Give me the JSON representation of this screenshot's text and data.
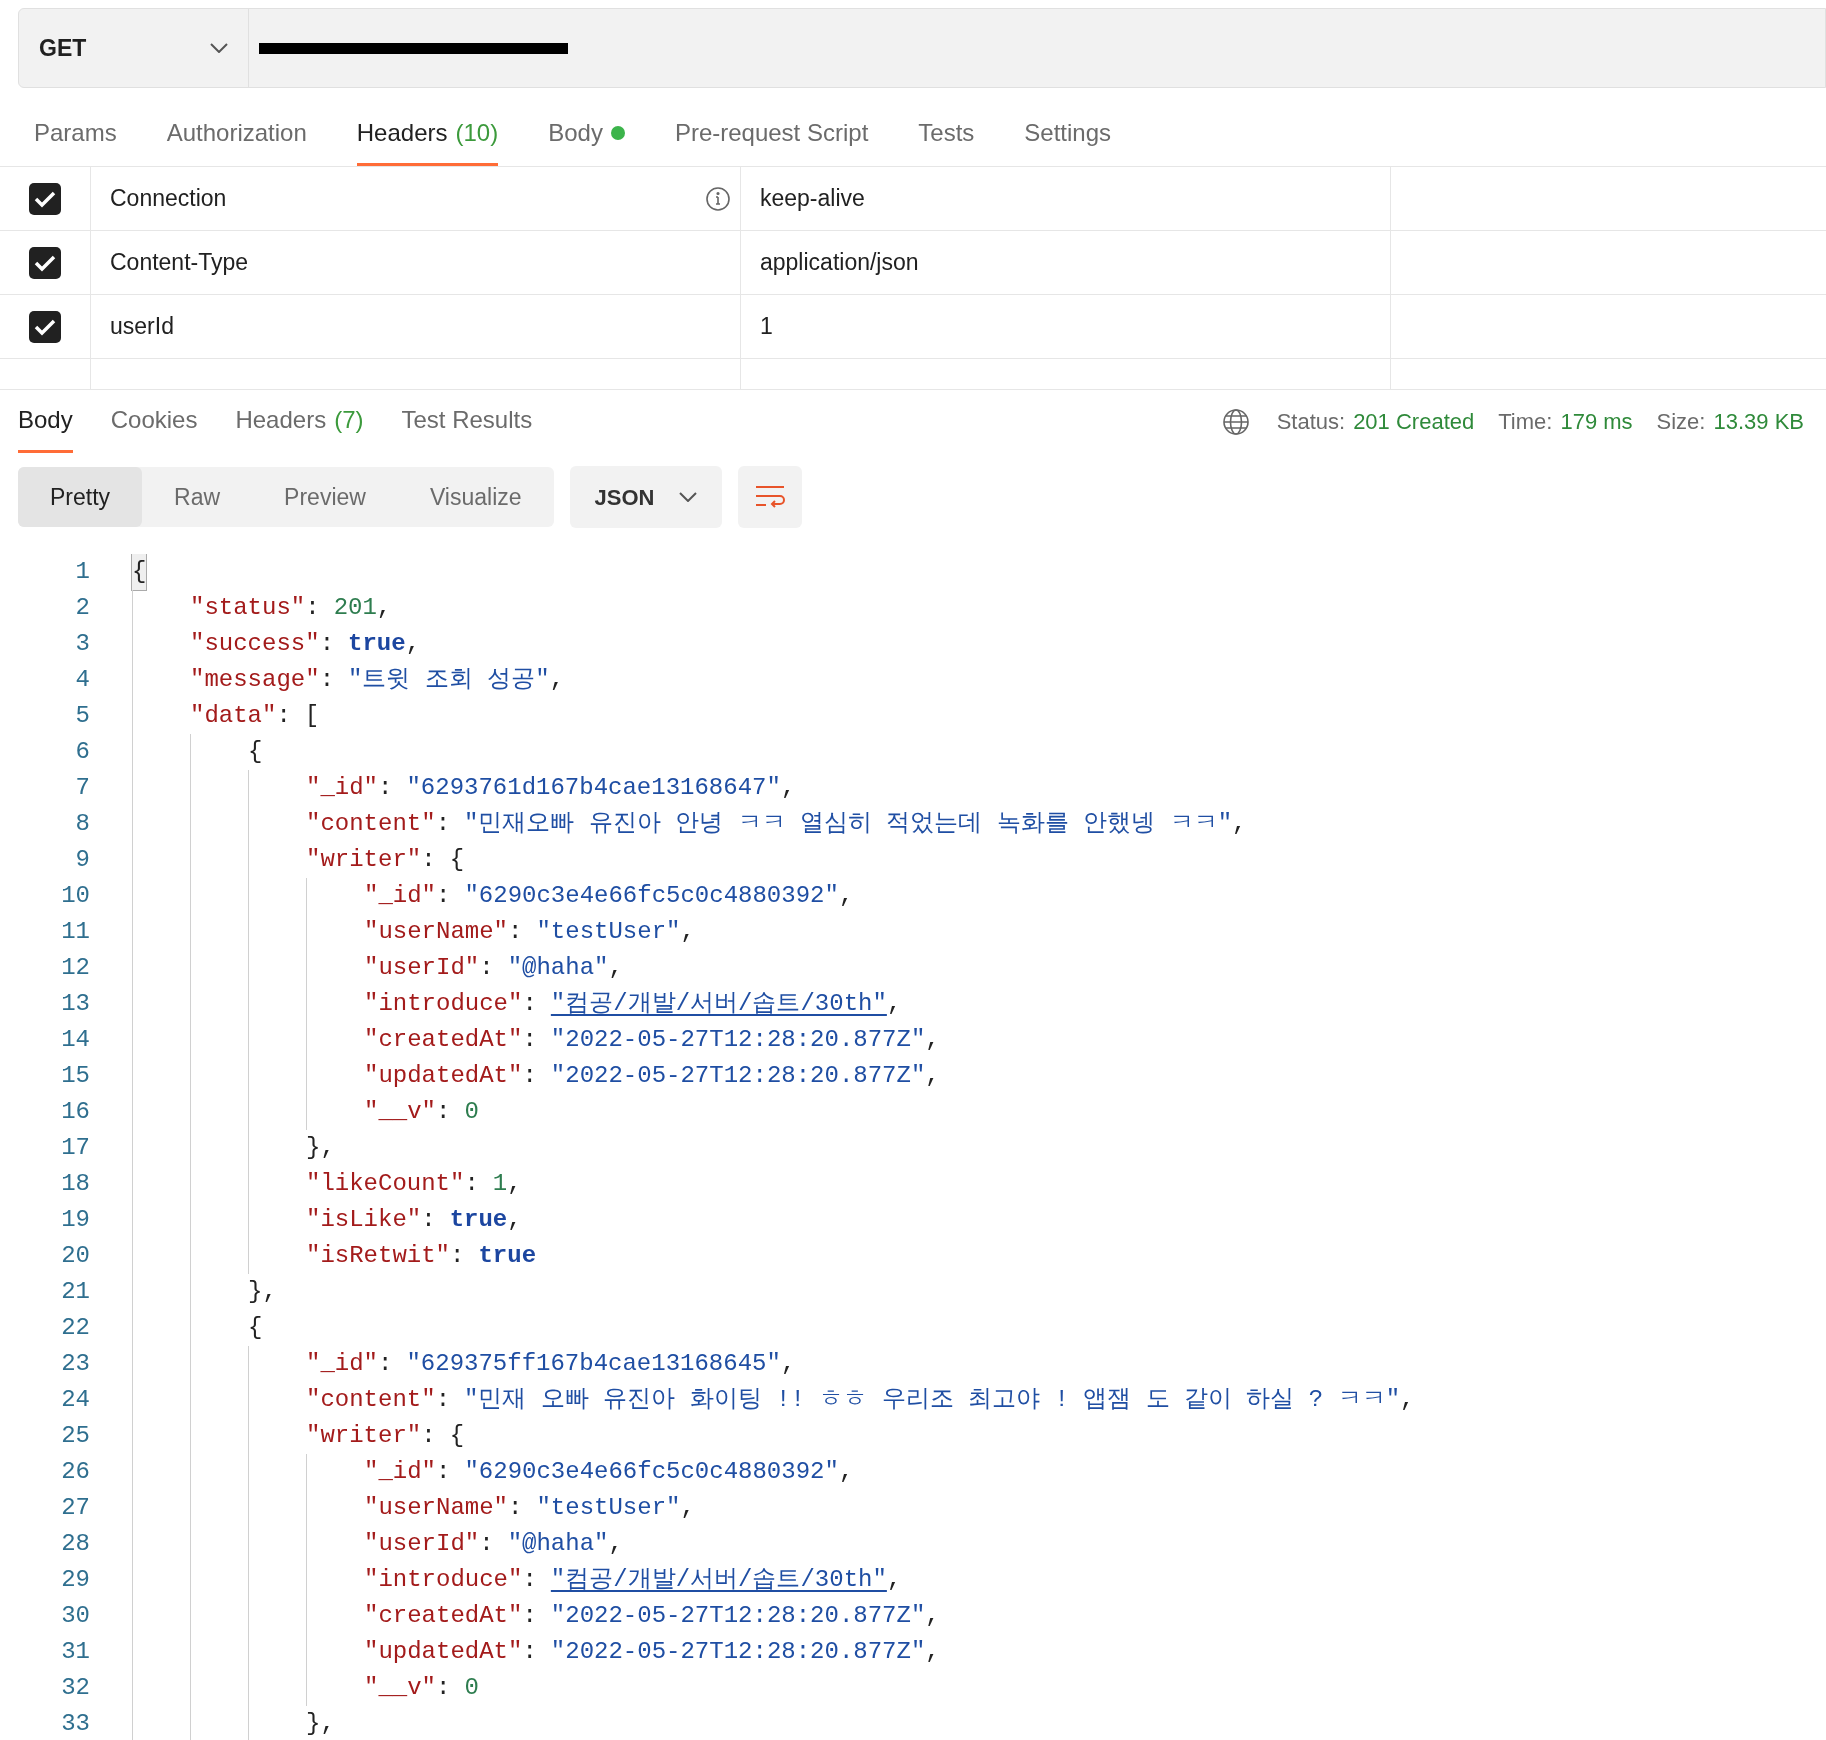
{
  "request": {
    "method": "GET",
    "tabs": [
      {
        "label": "Params",
        "selected": false
      },
      {
        "label": "Authorization",
        "selected": false
      },
      {
        "label": "Headers",
        "count": "(10)",
        "selected": true
      },
      {
        "label": "Body",
        "dot": true,
        "selected": false
      },
      {
        "label": "Pre-request Script",
        "selected": false
      },
      {
        "label": "Tests",
        "selected": false
      },
      {
        "label": "Settings",
        "selected": false
      }
    ],
    "headers": [
      {
        "checked": true,
        "key": "Connection",
        "info": true,
        "value": "keep-alive"
      },
      {
        "checked": true,
        "key": "Content-Type",
        "value": "application/json"
      },
      {
        "checked": true,
        "key": "userId",
        "value": "1"
      }
    ]
  },
  "response": {
    "tabs": [
      {
        "label": "Body",
        "selected": true
      },
      {
        "label": "Cookies",
        "selected": false
      },
      {
        "label": "Headers",
        "count": "(7)",
        "selected": false
      },
      {
        "label": "Test Results",
        "selected": false
      }
    ],
    "stats": [
      {
        "label": "Status:",
        "value": "201 Created"
      },
      {
        "label": "Time:",
        "value": "179 ms"
      },
      {
        "label": "Size:",
        "value": "13.39 KB"
      }
    ],
    "view_modes": [
      {
        "label": "Pretty",
        "selected": true
      },
      {
        "label": "Raw",
        "selected": false
      },
      {
        "label": "Preview",
        "selected": false
      },
      {
        "label": "Visualize",
        "selected": false
      }
    ],
    "format": "JSON",
    "lines": [
      {
        "n": "1",
        "tokens": [
          {
            "kind": "match",
            "text": "{"
          }
        ],
        "children": [
          {
            "n": "2",
            "tokens": [
              {
                "kind": "key",
                "text": "\"status\""
              },
              {
                "kind": "p",
                "text": ":"
              },
              {
                "kind": "num",
                "text": "201"
              },
              {
                "kind": "p",
                "text": ","
              }
            ]
          },
          {
            "n": "3",
            "tokens": [
              {
                "kind": "key",
                "text": "\"success\""
              },
              {
                "kind": "p",
                "text": ":"
              },
              {
                "kind": "bool",
                "text": "true"
              },
              {
                "kind": "p",
                "text": ","
              }
            ]
          },
          {
            "n": "4",
            "tokens": [
              {
                "kind": "key",
                "text": "\"message\""
              },
              {
                "kind": "p",
                "text": ":"
              },
              {
                "kind": "str",
                "text": "\"트윗 조회 성공\""
              },
              {
                "kind": "p",
                "text": ","
              }
            ]
          },
          {
            "n": "5",
            "tokens": [
              {
                "kind": "key",
                "text": "\"data\""
              },
              {
                "kind": "p",
                "text": ":"
              },
              {
                "kind": "p",
                "text": "["
              }
            ],
            "children": [
              {
                "n": "6",
                "tokens": [
                  {
                    "kind": "p",
                    "text": "{"
                  }
                ],
                "children": [
                  {
                    "n": "7",
                    "tokens": [
                      {
                        "kind": "key",
                        "text": "\"_id\""
                      },
                      {
                        "kind": "p",
                        "text": ":"
                      },
                      {
                        "kind": "str",
                        "text": "\"6293761d167b4cae13168647\""
                      },
                      {
                        "kind": "p",
                        "text": ","
                      }
                    ]
                  },
                  {
                    "n": "8",
                    "tokens": [
                      {
                        "kind": "key",
                        "text": "\"content\""
                      },
                      {
                        "kind": "p",
                        "text": ":"
                      },
                      {
                        "kind": "str",
                        "text": "\"민재오빠 유진아 안녕 ㅋㅋ 열심히 적었는데 녹화를 안했넹 ㅋㅋ\""
                      },
                      {
                        "kind": "p",
                        "text": ","
                      }
                    ]
                  },
                  {
                    "n": "9",
                    "tokens": [
                      {
                        "kind": "key",
                        "text": "\"writer\""
                      },
                      {
                        "kind": "p",
                        "text": ":"
                      },
                      {
                        "kind": "p",
                        "text": "{"
                      }
                    ],
                    "children": [
                      {
                        "n": "10",
                        "tokens": [
                          {
                            "kind": "key",
                            "text": "\"_id\""
                          },
                          {
                            "kind": "p",
                            "text": ":"
                          },
                          {
                            "kind": "str",
                            "text": "\"6290c3e4e66fc5c0c4880392\""
                          },
                          {
                            "kind": "p",
                            "text": ","
                          }
                        ]
                      },
                      {
                        "n": "11",
                        "tokens": [
                          {
                            "kind": "key",
                            "text": "\"userName\""
                          },
                          {
                            "kind": "p",
                            "text": ":"
                          },
                          {
                            "kind": "str",
                            "text": "\"testUser\""
                          },
                          {
                            "kind": "p",
                            "text": ","
                          }
                        ]
                      },
                      {
                        "n": "12",
                        "tokens": [
                          {
                            "kind": "key",
                            "text": "\"userId\""
                          },
                          {
                            "kind": "p",
                            "text": ":"
                          },
                          {
                            "kind": "str",
                            "text": "\"@haha\""
                          },
                          {
                            "kind": "p",
                            "text": ","
                          }
                        ]
                      },
                      {
                        "n": "13",
                        "tokens": [
                          {
                            "kind": "key",
                            "text": "\"introduce\""
                          },
                          {
                            "kind": "p",
                            "text": ":"
                          },
                          {
                            "kind": "link",
                            "text": "\"컴공/개발/서버/솝트/30th\""
                          },
                          {
                            "kind": "p",
                            "text": ","
                          }
                        ]
                      },
                      {
                        "n": "14",
                        "tokens": [
                          {
                            "kind": "key",
                            "text": "\"createdAt\""
                          },
                          {
                            "kind": "p",
                            "text": ":"
                          },
                          {
                            "kind": "str",
                            "text": "\"2022-05-27T12:28:20.877Z\""
                          },
                          {
                            "kind": "p",
                            "text": ","
                          }
                        ]
                      },
                      {
                        "n": "15",
                        "tokens": [
                          {
                            "kind": "key",
                            "text": "\"updatedAt\""
                          },
                          {
                            "kind": "p",
                            "text": ":"
                          },
                          {
                            "kind": "str",
                            "text": "\"2022-05-27T12:28:20.877Z\""
                          },
                          {
                            "kind": "p",
                            "text": ","
                          }
                        ]
                      },
                      {
                        "n": "16",
                        "tokens": [
                          {
                            "kind": "key",
                            "text": "\"__v\""
                          },
                          {
                            "kind": "p",
                            "text": ":"
                          },
                          {
                            "kind": "num",
                            "text": "0"
                          }
                        ]
                      }
                    ]
                  },
                  {
                    "n": "17",
                    "tokens": [
                      {
                        "kind": "p",
                        "text": "},"
                      }
                    ]
                  },
                  {
                    "n": "18",
                    "tokens": [
                      {
                        "kind": "key",
                        "text": "\"likeCount\""
                      },
                      {
                        "kind": "p",
                        "text": ":"
                      },
                      {
                        "kind": "num",
                        "text": "1"
                      },
                      {
                        "kind": "p",
                        "text": ","
                      }
                    ]
                  },
                  {
                    "n": "19",
                    "tokens": [
                      {
                        "kind": "key",
                        "text": "\"isLike\""
                      },
                      {
                        "kind": "p",
                        "text": ":"
                      },
                      {
                        "kind": "bool",
                        "text": "true"
                      },
                      {
                        "kind": "p",
                        "text": ","
                      }
                    ]
                  },
                  {
                    "n": "20",
                    "tokens": [
                      {
                        "kind": "key",
                        "text": "\"isRetwit\""
                      },
                      {
                        "kind": "p",
                        "text": ":"
                      },
                      {
                        "kind": "bool",
                        "text": "true"
                      }
                    ]
                  }
                ]
              },
              {
                "n": "21",
                "tokens": [
                  {
                    "kind": "p",
                    "text": "},"
                  }
                ]
              },
              {
                "n": "22",
                "tokens": [
                  {
                    "kind": "p",
                    "text": "{"
                  }
                ],
                "children": [
                  {
                    "n": "23",
                    "tokens": [
                      {
                        "kind": "key",
                        "text": "\"_id\""
                      },
                      {
                        "kind": "p",
                        "text": ":"
                      },
                      {
                        "kind": "str",
                        "text": "\"629375ff167b4cae13168645\""
                      },
                      {
                        "kind": "p",
                        "text": ","
                      }
                    ]
                  },
                  {
                    "n": "24",
                    "tokens": [
                      {
                        "kind": "key",
                        "text": "\"content\""
                      },
                      {
                        "kind": "p",
                        "text": ":"
                      },
                      {
                        "kind": "str",
                        "text": "\"민재 오빠 유진아 화이팅 !! ㅎㅎ 우리조 최고야 ! 앱잼 도 같이 하실 ? ㅋㅋ\""
                      },
                      {
                        "kind": "p",
                        "text": ","
                      }
                    ]
                  },
                  {
                    "n": "25",
                    "tokens": [
                      {
                        "kind": "key",
                        "text": "\"writer\""
                      },
                      {
                        "kind": "p",
                        "text": ":"
                      },
                      {
                        "kind": "p",
                        "text": "{"
                      }
                    ],
                    "children": [
                      {
                        "n": "26",
                        "tokens": [
                          {
                            "kind": "key",
                            "text": "\"_id\""
                          },
                          {
                            "kind": "p",
                            "text": ":"
                          },
                          {
                            "kind": "str",
                            "text": "\"6290c3e4e66fc5c0c4880392\""
                          },
                          {
                            "kind": "p",
                            "text": ","
                          }
                        ]
                      },
                      {
                        "n": "27",
                        "tokens": [
                          {
                            "kind": "key",
                            "text": "\"userName\""
                          },
                          {
                            "kind": "p",
                            "text": ":"
                          },
                          {
                            "kind": "str",
                            "text": "\"testUser\""
                          },
                          {
                            "kind": "p",
                            "text": ","
                          }
                        ]
                      },
                      {
                        "n": "28",
                        "tokens": [
                          {
                            "kind": "key",
                            "text": "\"userId\""
                          },
                          {
                            "kind": "p",
                            "text": ":"
                          },
                          {
                            "kind": "str",
                            "text": "\"@haha\""
                          },
                          {
                            "kind": "p",
                            "text": ","
                          }
                        ]
                      },
                      {
                        "n": "29",
                        "tokens": [
                          {
                            "kind": "key",
                            "text": "\"introduce\""
                          },
                          {
                            "kind": "p",
                            "text": ":"
                          },
                          {
                            "kind": "link",
                            "text": "\"컴공/개발/서버/솝트/30th\""
                          },
                          {
                            "kind": "p",
                            "text": ","
                          }
                        ]
                      },
                      {
                        "n": "30",
                        "tokens": [
                          {
                            "kind": "key",
                            "text": "\"createdAt\""
                          },
                          {
                            "kind": "p",
                            "text": ":"
                          },
                          {
                            "kind": "str",
                            "text": "\"2022-05-27T12:28:20.877Z\""
                          },
                          {
                            "kind": "p",
                            "text": ","
                          }
                        ]
                      },
                      {
                        "n": "31",
                        "tokens": [
                          {
                            "kind": "key",
                            "text": "\"updatedAt\""
                          },
                          {
                            "kind": "p",
                            "text": ":"
                          },
                          {
                            "kind": "str",
                            "text": "\"2022-05-27T12:28:20.877Z\""
                          },
                          {
                            "kind": "p",
                            "text": ","
                          }
                        ]
                      },
                      {
                        "n": "32",
                        "tokens": [
                          {
                            "kind": "key",
                            "text": "\"__v\""
                          },
                          {
                            "kind": "p",
                            "text": ":"
                          },
                          {
                            "kind": "num",
                            "text": "0"
                          }
                        ]
                      }
                    ]
                  },
                  {
                    "n": "33",
                    "tokens": [
                      {
                        "kind": "p",
                        "text": "},"
                      }
                    ]
                  }
                ]
              }
            ]
          }
        ]
      }
    ]
  }
}
